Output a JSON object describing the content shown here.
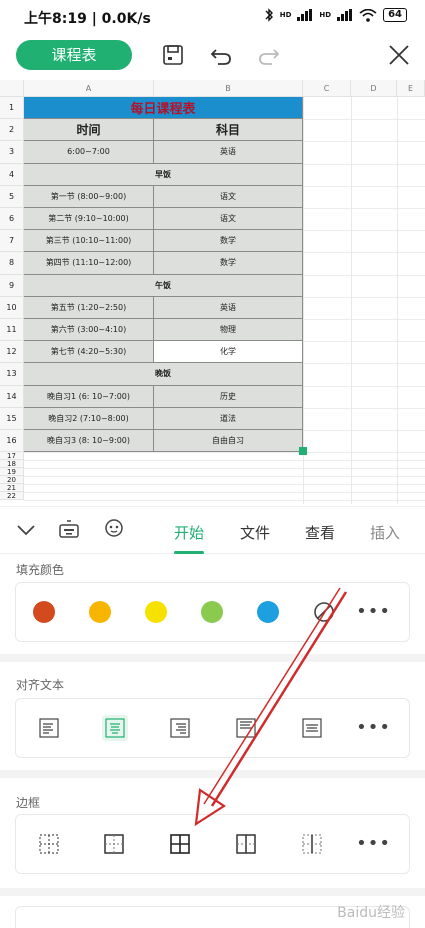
{
  "status": {
    "time": "上午8:19 | 0.0K/s",
    "battery": "64",
    "net1": "HD",
    "net2": "HD"
  },
  "toolbar": {
    "title": "课程表"
  },
  "columns": [
    "A",
    "B",
    "C",
    "D",
    "E"
  ],
  "rows": [
    "1",
    "2",
    "3",
    "4",
    "5",
    "6",
    "7",
    "8",
    "9",
    "10",
    "11",
    "12",
    "13",
    "14",
    "15",
    "16",
    "17",
    "18",
    "19",
    "20",
    "21",
    "22"
  ],
  "table": {
    "title": "每日课程表",
    "header": [
      "时间",
      "科目"
    ],
    "body": [
      [
        "6:00~7:00",
        "英语"
      ],
      [
        "早饭",
        ""
      ],
      [
        "第一节 (8:00~9:00)",
        "语文"
      ],
      [
        "第二节 (9:10~10:00)",
        "语文"
      ],
      [
        "第三节 (10:10~11:00)",
        "数学"
      ],
      [
        "第四节 (11:10~12:00)",
        "数学"
      ],
      [
        "午饭",
        ""
      ],
      [
        "第五节 (1:20~2:50)",
        "英语"
      ],
      [
        "第六节 (3:00~4:10)",
        "物理"
      ],
      [
        "第七节 (4:20~5:30)",
        "化学"
      ],
      [
        "晚饭",
        ""
      ],
      [
        "晚自习1 (6: 10~7:00)",
        "历史"
      ],
      [
        "晚自习2 (7:10~8:00)",
        "道法"
      ],
      [
        "晚自习3 (8: 10~9:00)",
        "自由自习"
      ]
    ]
  },
  "tabs": [
    "开始",
    "文件",
    "查看",
    "插入"
  ],
  "sections": {
    "fill": {
      "title": "填充颜色",
      "colors": [
        "#d24a1d",
        "#f7b500",
        "#f6e100",
        "#8acb4f",
        "#1e9fe0"
      ]
    },
    "align": {
      "title": "对齐文本"
    },
    "border": {
      "title": "边框"
    }
  },
  "more_label": "•••",
  "watermark": "Baidu经验"
}
